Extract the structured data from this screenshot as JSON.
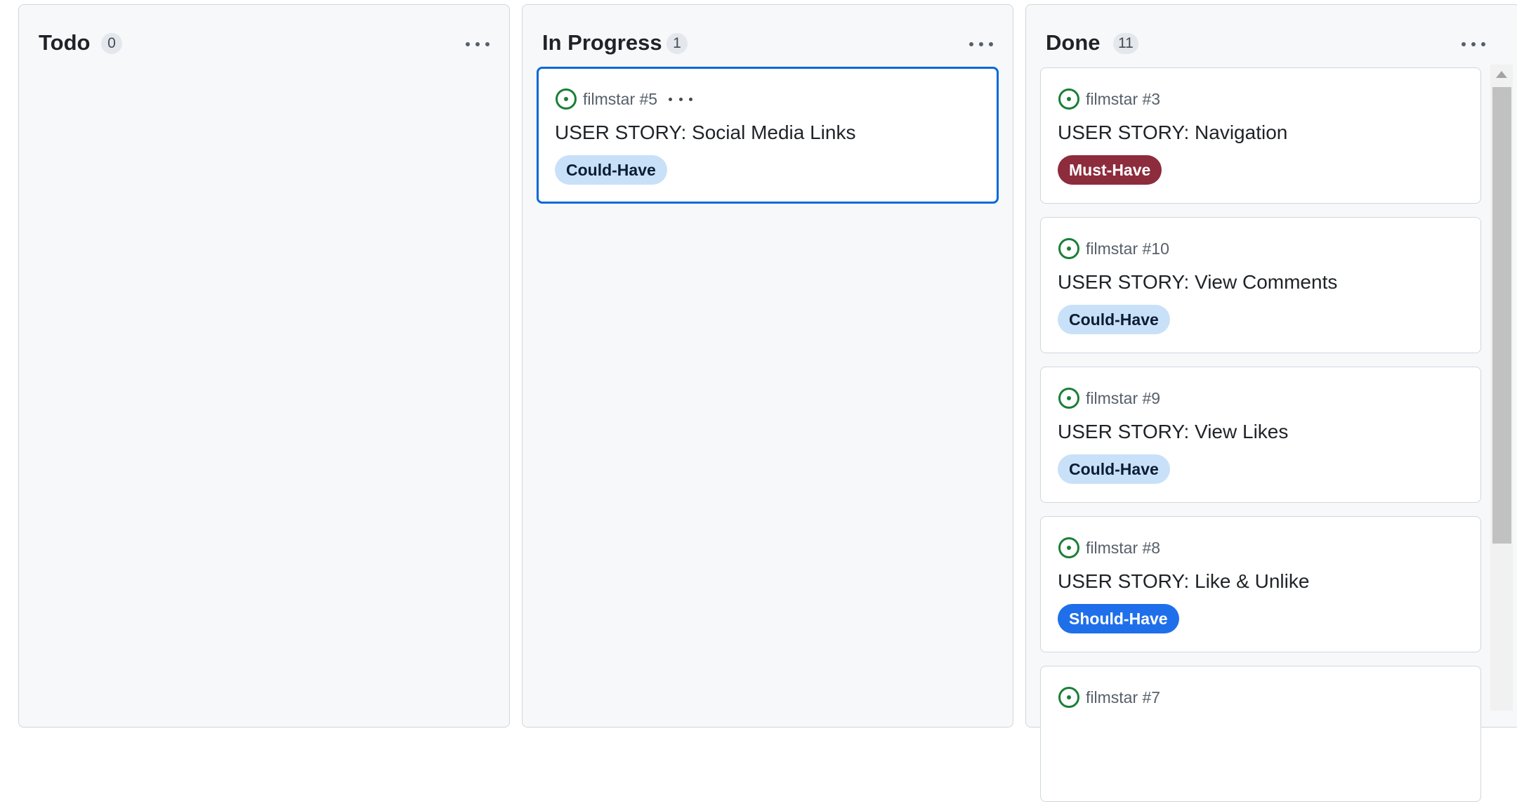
{
  "columns": [
    {
      "title": "Todo",
      "count": "0",
      "cards": []
    },
    {
      "title": "In Progress",
      "count": "1",
      "cards": [
        {
          "repo": "filmstar #5",
          "title": "USER STORY: Social Media Links",
          "label": "Could-Have",
          "label_bg": "#c8e1f9",
          "label_fg": "#0b1d33"
        }
      ]
    },
    {
      "title": "Done",
      "count": "11",
      "cards": [
        {
          "repo": "filmstar #3",
          "title": "USER STORY: Navigation",
          "label": "Must-Have",
          "label_bg": "#8c2c3d",
          "label_fg": "#ffffff"
        },
        {
          "repo": "filmstar #10",
          "title": "USER STORY: View Comments",
          "label": "Could-Have",
          "label_bg": "#c8e1f9",
          "label_fg": "#0b1d33"
        },
        {
          "repo": "filmstar #9",
          "title": "USER STORY: View Likes",
          "label": "Could-Have",
          "label_bg": "#c8e1f9",
          "label_fg": "#0b1d33"
        },
        {
          "repo": "filmstar #8",
          "title": "USER STORY: Like & Unlike",
          "label": "Should-Have",
          "label_bg": "#1f6feb",
          "label_fg": "#ffffff"
        },
        {
          "repo": "filmstar #7"
        }
      ]
    }
  ],
  "colors": {
    "open_issue": "#1a7f37",
    "selected_border": "#0969da"
  },
  "icons": {
    "issue": "issue-opened-icon",
    "menu": "kebab-horizontal-icon"
  }
}
